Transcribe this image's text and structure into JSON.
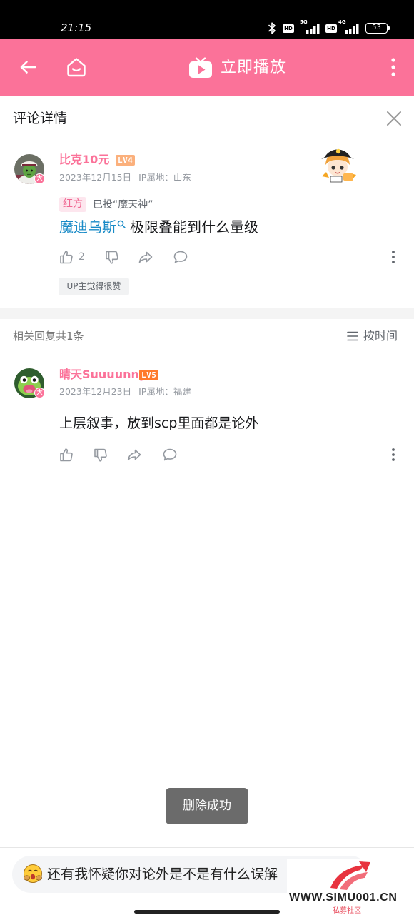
{
  "status_bar": {
    "time": "21:15",
    "network_1": {
      "hd": "HD",
      "type": "5G"
    },
    "network_2": {
      "hd": "HD",
      "type": "4G"
    },
    "battery": "53"
  },
  "top_bar": {
    "play_label": "立即播放"
  },
  "panel": {
    "title": "评论详情"
  },
  "comment": {
    "avatar_badge": "大",
    "username": "比克10元",
    "level": "LV4",
    "date": "2023年12月15日",
    "ip": "IP属地：山东",
    "vote_tag": "红方",
    "vote_text": "已投“魔天神”",
    "link_text": "魔迪乌斯",
    "text": "极限叠能到什么量级",
    "like_count": "2",
    "up_tag": "UP主觉得很赞"
  },
  "replies": {
    "count_label": "相关回复共1条",
    "sort_label": "按时间",
    "items": [
      {
        "avatar_badge": "大",
        "username": "晴天Suuuunny",
        "level": "LV5",
        "date": "2023年12月23日",
        "ip": "IP属地：福建",
        "text": "上层叙事，放到scp里面都是论外"
      }
    ]
  },
  "toast": "删除成功",
  "composer": {
    "value": "还有我怀疑你对论外是不是有什么误解"
  },
  "watermark": {
    "url": "WWW.SIMU001.CN",
    "name": "私募社区"
  },
  "icons": {
    "back": "arrow-left-icon",
    "home": "home-icon",
    "tv": "tv-play-icon",
    "more": "more-vertical-icon",
    "close": "close-icon",
    "like": "thumbs-up-icon",
    "dislike": "thumbs-down-icon",
    "share": "share-icon",
    "reply": "comment-bubble-icon",
    "search": "search-icon",
    "sort": "sort-list-icon",
    "emoji": "emoji-face-icon"
  },
  "colors": {
    "accent": "#fb7299",
    "link": "#1a8bc7",
    "level_4": "#fbb07c",
    "level_5": "#ff7a2b",
    "toast_bg": "#6b6b6b"
  }
}
